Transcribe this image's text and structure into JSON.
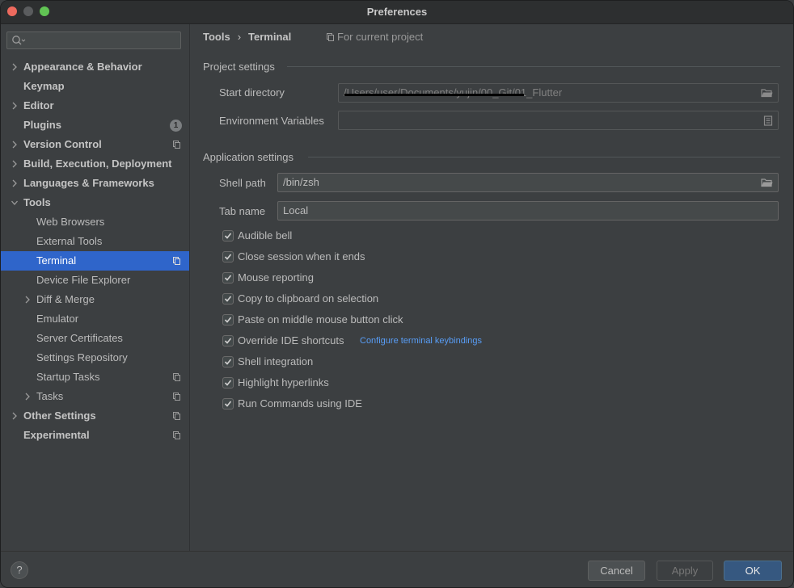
{
  "window": {
    "title": "Preferences"
  },
  "sidebar": {
    "search_placeholder": "",
    "items": [
      {
        "label": "Appearance & Behavior",
        "bold": true,
        "expandable": true,
        "expanded": false,
        "level": 0
      },
      {
        "label": "Keymap",
        "bold": true,
        "expandable": false,
        "level": 0
      },
      {
        "label": "Editor",
        "bold": true,
        "expandable": true,
        "expanded": false,
        "level": 0
      },
      {
        "label": "Plugins",
        "bold": true,
        "expandable": false,
        "level": 0,
        "badge": "1"
      },
      {
        "label": "Version Control",
        "bold": true,
        "expandable": true,
        "expanded": false,
        "level": 0,
        "project_icon": true
      },
      {
        "label": "Build, Execution, Deployment",
        "bold": true,
        "expandable": true,
        "expanded": false,
        "level": 0
      },
      {
        "label": "Languages & Frameworks",
        "bold": true,
        "expandable": true,
        "expanded": false,
        "level": 0
      },
      {
        "label": "Tools",
        "bold": true,
        "expandable": true,
        "expanded": true,
        "level": 0
      },
      {
        "label": "Web Browsers",
        "bold": false,
        "expandable": false,
        "level": 1
      },
      {
        "label": "External Tools",
        "bold": false,
        "expandable": false,
        "level": 1
      },
      {
        "label": "Terminal",
        "bold": false,
        "expandable": false,
        "level": 1,
        "selected": true,
        "project_icon": true
      },
      {
        "label": "Device File Explorer",
        "bold": false,
        "expandable": false,
        "level": 1
      },
      {
        "label": "Diff & Merge",
        "bold": false,
        "expandable": true,
        "expanded": false,
        "level": 1
      },
      {
        "label": "Emulator",
        "bold": false,
        "expandable": false,
        "level": 1
      },
      {
        "label": "Server Certificates",
        "bold": false,
        "expandable": false,
        "level": 1
      },
      {
        "label": "Settings Repository",
        "bold": false,
        "expandable": false,
        "level": 1
      },
      {
        "label": "Startup Tasks",
        "bold": false,
        "expandable": false,
        "level": 1,
        "project_icon": true
      },
      {
        "label": "Tasks",
        "bold": false,
        "expandable": true,
        "expanded": false,
        "level": 1,
        "project_icon": true
      },
      {
        "label": "Other Settings",
        "bold": true,
        "expandable": true,
        "expanded": false,
        "level": 0,
        "project_icon": true
      },
      {
        "label": "Experimental",
        "bold": true,
        "expandable": false,
        "level": 0,
        "project_icon": true
      }
    ]
  },
  "breadcrumb": {
    "parent": "Tools",
    "separator": "›",
    "current": "Terminal",
    "scope": "For current project"
  },
  "project_settings": {
    "title": "Project settings",
    "start_directory": {
      "label": "Start directory",
      "value": "/Users/user/Documents/yujin/00_Git/01_Flutter"
    },
    "env_vars": {
      "label": "Environment Variables",
      "value": ""
    }
  },
  "application_settings": {
    "title": "Application settings",
    "shell_path": {
      "label": "Shell path",
      "value": "/bin/zsh"
    },
    "tab_name": {
      "label": "Tab name",
      "value": "Local"
    },
    "checkboxes": [
      {
        "label": "Audible bell",
        "checked": true
      },
      {
        "label": "Close session when it ends",
        "checked": true
      },
      {
        "label": "Mouse reporting",
        "checked": true
      },
      {
        "label": "Copy to clipboard on selection",
        "checked": true
      },
      {
        "label": "Paste on middle mouse button click",
        "checked": true
      },
      {
        "label": "Override IDE shortcuts",
        "checked": true
      },
      {
        "label": "Shell integration",
        "checked": true
      },
      {
        "label": "Highlight hyperlinks",
        "checked": true
      },
      {
        "label": "Run Commands using IDE",
        "checked": true
      }
    ],
    "keybindings_link": "Configure terminal keybindings"
  },
  "footer": {
    "help": "?",
    "cancel": "Cancel",
    "apply": "Apply",
    "ok": "OK"
  },
  "colors": {
    "selection": "#2f65ca",
    "link": "#589df6",
    "ok_button": "#365880",
    "background": "#3c3f41"
  }
}
